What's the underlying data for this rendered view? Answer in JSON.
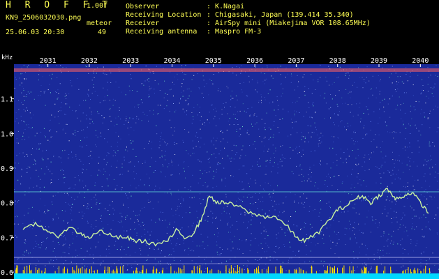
{
  "header": {
    "app_title": "H R O F F T",
    "version": "1.00f",
    "filename": "KN9_2506032030.png",
    "meteor_label": "meteor",
    "datetime": "25.06.03 20:30",
    "meteor_count": "49",
    "info": [
      {
        "label": "Observer",
        "value": "K.Nagai"
      },
      {
        "label": "Receiving Location",
        "value": "Chigasaki, Japan (139.414 35.340)"
      },
      {
        "label": "Receiver",
        "value": "AirSpy mini (Miakejima VOR 108.65MHz)"
      },
      {
        "label": "Receiving antenna",
        "value": "Maspro FM-3"
      }
    ],
    "separator": ":"
  },
  "plot": {
    "unit_label": "kHz",
    "time_ticks": [
      "2031",
      "2032",
      "2033",
      "2034",
      "2035",
      "2036",
      "2037",
      "2038",
      "2039",
      "2040"
    ],
    "freq_ticks": [
      "1.1",
      "1.0",
      "0.9",
      "0.8",
      "0.7",
      "0.6"
    ],
    "colors": {
      "background": "#1a2a9a",
      "trace": "#c8f0a0",
      "band": "#ff6060",
      "hline": "#5fd8d8",
      "floor": "#00d8ff",
      "spikes": "#ffe000"
    }
  },
  "chart_data": {
    "type": "line",
    "xlabel": "",
    "ylabel": "kHz",
    "x_ticks": [
      "2031",
      "2032",
      "2033",
      "2034",
      "2035",
      "2036",
      "2037",
      "2038",
      "2039",
      "2040"
    ],
    "ylim": [
      0.58,
      1.2
    ],
    "series": [
      {
        "x": [
          2030.4,
          2030.7,
          2031.0,
          2031.2,
          2031.5,
          2031.8,
          2032.0,
          2032.3,
          2032.6,
          2032.9,
          2033.1,
          2033.3,
          2033.6,
          2033.9,
          2034.1,
          2034.3,
          2034.5,
          2034.7,
          2034.9,
          2035.1,
          2035.3,
          2035.6,
          2035.9,
          2036.2,
          2036.5,
          2036.8,
          2037.0,
          2037.2,
          2037.5,
          2037.8,
          2038.0,
          2038.2,
          2038.4,
          2038.6,
          2038.8,
          2039.0,
          2039.2,
          2039.4,
          2039.6,
          2039.8,
          2040.0,
          2040.2
        ],
        "y": [
          0.72,
          0.74,
          0.72,
          0.7,
          0.73,
          0.71,
          0.7,
          0.72,
          0.7,
          0.7,
          0.69,
          0.69,
          0.68,
          0.69,
          0.72,
          0.7,
          0.71,
          0.75,
          0.82,
          0.8,
          0.8,
          0.79,
          0.77,
          0.76,
          0.76,
          0.73,
          0.7,
          0.69,
          0.71,
          0.75,
          0.78,
          0.79,
          0.81,
          0.82,
          0.8,
          0.82,
          0.84,
          0.81,
          0.82,
          0.83,
          0.8,
          0.77
        ]
      }
    ]
  }
}
